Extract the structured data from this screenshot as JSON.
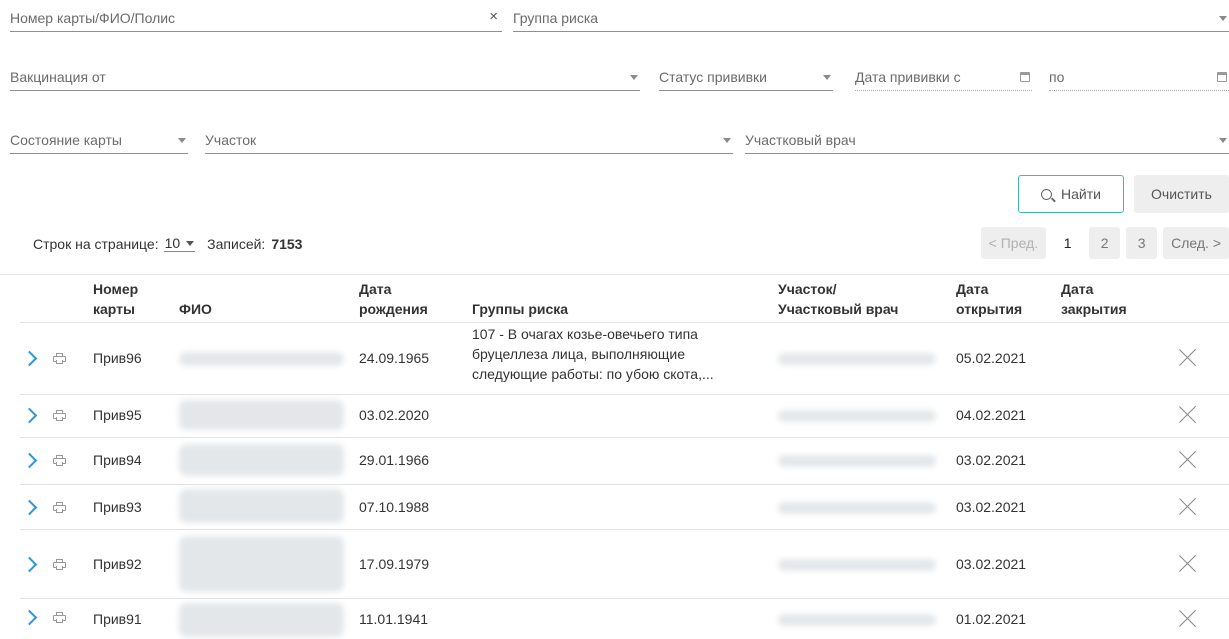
{
  "filters": {
    "card_number_placeholder": "Номер карты/ФИО/Полис",
    "clear_symbol": "×",
    "risk_group_placeholder": "Группа риска",
    "vaccination_from_placeholder": "Вакцинация от",
    "vaccination_status_placeholder": "Статус прививки",
    "vaccination_date_from_placeholder": "Дата прививки с",
    "vaccination_date_to_placeholder": "по",
    "card_state_placeholder": "Состояние карты",
    "district_placeholder": "Участок",
    "district_doctor_placeholder": "Участковый врач"
  },
  "actions": {
    "find_label": "Найти",
    "clear_label": "Очистить"
  },
  "meta": {
    "rows_per_page_label": "Строк на странице:",
    "rows_per_page_value": "10",
    "records_label": "Записей:",
    "records_count": "7153"
  },
  "pagination": {
    "prev_label": "< Пред.",
    "pages": [
      "1",
      "2",
      "3"
    ],
    "current_page": "1",
    "next_label": "След. >"
  },
  "table": {
    "headers": {
      "card_number_line1": "Номер",
      "card_number_line2": "карты",
      "fio": "ФИО",
      "birth_line1": "Дата",
      "birth_line2": "рождения",
      "risk_groups": "Группы риска",
      "district_line1": "Участок/",
      "district_line2": "Участковый врач",
      "open_line1": "Дата",
      "open_line2": "открытия",
      "close_line1": "Дата",
      "close_line2": "закрытия"
    },
    "rows": [
      {
        "card": "Прив96",
        "birth": "24.09.1965",
        "risk_lines": [
          "107 - В очагах козье-овечьего типа",
          "бруцеллеза лица, выполняющие",
          "следующие работы: по убою скота,..."
        ],
        "opened": "05.02.2021",
        "closed": ""
      },
      {
        "card": "Прив95",
        "birth": "03.02.2020",
        "risk_lines": [],
        "opened": "04.02.2021",
        "closed": ""
      },
      {
        "card": "Прив94",
        "birth": "29.01.1966",
        "risk_lines": [],
        "opened": "03.02.2021",
        "closed": ""
      },
      {
        "card": "Прив93",
        "birth": "07.10.1988",
        "risk_lines": [],
        "opened": "03.02.2021",
        "closed": ""
      },
      {
        "card": "Прив92",
        "birth": "17.09.1979",
        "risk_lines": [],
        "opened": "03.02.2021",
        "closed": ""
      },
      {
        "card": "Прив91",
        "birth": "11.01.1941",
        "risk_lines": [],
        "opened": "01.02.2021",
        "closed": ""
      }
    ]
  },
  "icons": {
    "expand": "chevron-right-icon",
    "print": "printer-icon",
    "delete": "close-icon",
    "search": "search-icon",
    "calendar": "calendar-icon"
  },
  "colors": {
    "accent": "#2d97d8",
    "find_border": "#45b6b6"
  }
}
